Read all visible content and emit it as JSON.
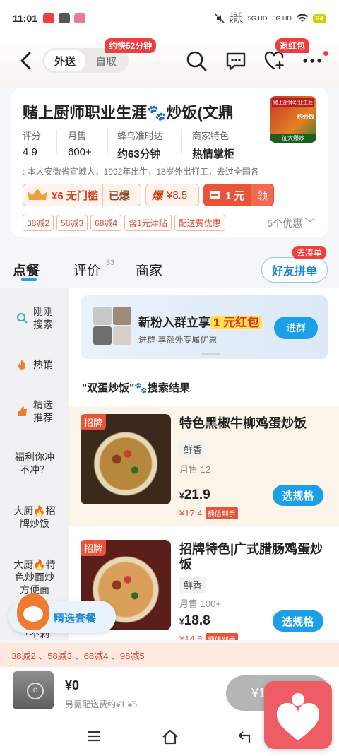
{
  "status": {
    "time": "11:01",
    "net_speed": "16.0",
    "net_unit": "KB/s",
    "signal1": "5G HD",
    "signal2": "5G HD",
    "battery": "94"
  },
  "nav": {
    "mode_active": "外送",
    "mode_inactive": "自取",
    "promo_bubble": "约快52分钟",
    "hongbao_bubble": "返红包"
  },
  "store": {
    "name": "赌上厨师职业生涯🐾炒饭(文鼎",
    "thumb_top": "赌上厨师职业生涯",
    "thumb_mid": "约炒饭",
    "thumb_bottom": "征大爆炒",
    "stats": [
      {
        "label": "评分",
        "value": "4.9"
      },
      {
        "label": "月售",
        "value": "600+"
      },
      {
        "label": "蜂鸟准时达",
        "value": "约63分钟"
      },
      {
        "label": "商家特色",
        "value": "热情掌柜"
      }
    ],
    "intro": ": 本人安徽省宣城人，1992年出生，18岁外出打工，去过全国各",
    "perk_min": "¥6 无门槛",
    "perk_min_state": "已爆",
    "perk_boom_label": "爆",
    "perk_boom_value": "¥8.5",
    "perk_coupon_value": "1 元",
    "perk_coupon_action": "领",
    "coupons": [
      "38减2",
      "58减3",
      "68减4",
      "含1元津贴",
      "配送费优惠"
    ],
    "coupons_more": "5个优惠"
  },
  "tabs": {
    "order": "点餐",
    "reviews": "评价",
    "reviews_count": "33",
    "merchant": "商家",
    "group": "好友拼单",
    "group_bubble": "去凑单"
  },
  "sidebar": {
    "items": [
      {
        "label": "刚刚\n搜索"
      },
      {
        "label": "热销"
      },
      {
        "label": "精选\n推荐"
      },
      {
        "label": "福利你冲\n不冲？"
      },
      {
        "label": "大厨🔥招\n牌炒饭"
      },
      {
        "label": "大厨🔥特\n色炒面炒\n方便面"
      },
      {
        "label": "「不剁"
      }
    ]
  },
  "banner": {
    "title_pre": "新粉入群立享",
    "title_hl": "1 元红包",
    "sub": "进群 享额外专属优惠",
    "join": "进群"
  },
  "search_result": "\"双蛋炒饭\"🐾搜索结果",
  "dishes": [
    {
      "tag": "招牌",
      "name": "特色黑椒牛柳鸡蛋炒饭",
      "flavor": "鲜香",
      "sales": "月售 12",
      "price_sym": "¥",
      "price": "21.9",
      "est_price": "¥17.4",
      "est_badge": "预估到手",
      "spec": "选规格"
    },
    {
      "tag": "招牌",
      "name": "招牌特色|广式腊肠鸡蛋炒饭",
      "flavor": "鲜香",
      "sales": "月售 100+",
      "price_sym": "¥",
      "price": "18.8",
      "est_price": "¥14.8",
      "est_badge": "预估到手",
      "spec": "选规格"
    }
  ],
  "setmeal": "精选套餐",
  "discount_strip": "38减2 、58减3 、68减4 、98减5",
  "cart": {
    "total": "¥0",
    "fee": "另需配送费约¥1 ¥5",
    "checkout": "¥1"
  }
}
